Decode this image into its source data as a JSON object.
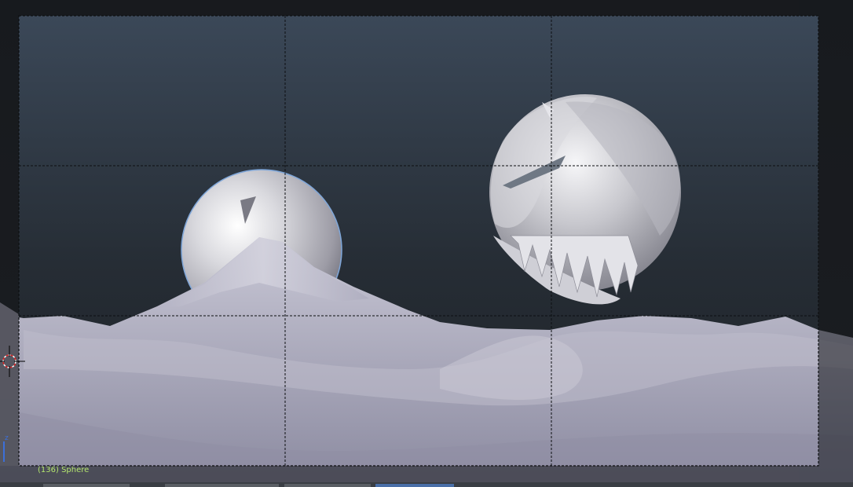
{
  "viewport": {
    "object_info": "(136) Sphere",
    "axis_label": "z"
  },
  "colors": {
    "background_top": "#3a4756",
    "background_bottom": "#1f2328",
    "object_info": "#b4e66e",
    "selection_outline": "#7fa6d8",
    "axis_z": "#3c6fd8"
  }
}
